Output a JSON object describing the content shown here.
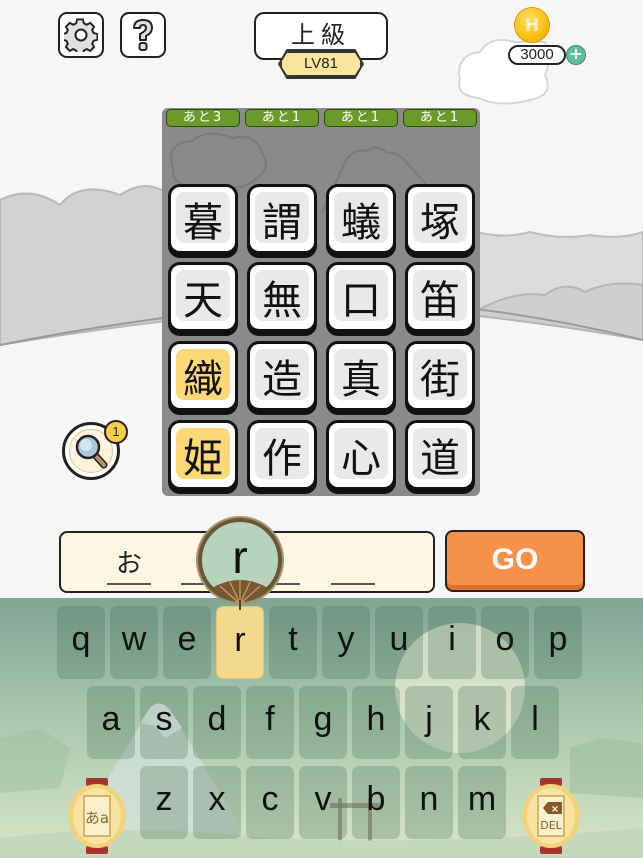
{
  "header": {
    "settings_icon": "gear-icon",
    "help_icon": "question-icon",
    "difficulty": "上級",
    "level": "LV81",
    "coin_icon_letter": "H",
    "coins": "3000",
    "add_coins_label": "+"
  },
  "board": {
    "column_tags": [
      "あと3",
      "あと1",
      "あと1",
      "あと1"
    ],
    "rows": [
      [
        "暮",
        "謂",
        "蟻",
        "塚"
      ],
      [
        "天",
        "無",
        "口",
        "笛"
      ],
      [
        "織",
        "造",
        "真",
        "街"
      ],
      [
        "姫",
        "作",
        "心",
        "道"
      ]
    ],
    "selected": [
      [
        2,
        0
      ],
      [
        3,
        0
      ]
    ]
  },
  "hint": {
    "icon": "magnifier-icon",
    "count": "1"
  },
  "answer": {
    "slots": [
      "お",
      "",
      "",
      ""
    ],
    "popup_letter": "r",
    "go_label": "GO"
  },
  "keyboard": {
    "row1": [
      "q",
      "w",
      "e",
      "r",
      "t",
      "y",
      "u",
      "i",
      "o",
      "p"
    ],
    "row2": [
      "a",
      "s",
      "d",
      "f",
      "g",
      "h",
      "j",
      "k",
      "l"
    ],
    "row3": [
      "z",
      "x",
      "c",
      "v",
      "b",
      "n",
      "m"
    ],
    "active_key": "r",
    "kana_toggle_label": "あa",
    "delete_label": "DEL"
  },
  "colors": {
    "go_button": "#f6914a",
    "selected_tile": "#fbd977",
    "column_tag": "#6a9a2a",
    "level_tag": "#fbe49b"
  }
}
